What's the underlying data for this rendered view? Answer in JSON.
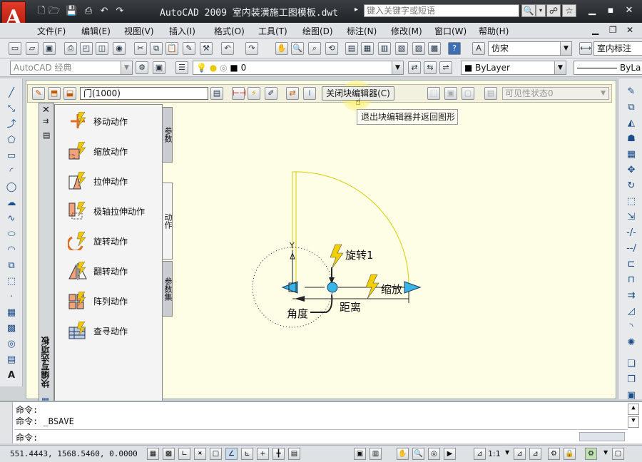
{
  "window": {
    "title": "AutoCAD 2009  室内装潢施工图模板.dwt",
    "search_placeholder": "键入关键字或短语"
  },
  "menu": [
    "文件(F)",
    "编辑(E)",
    "视图(V)",
    "插入(I)",
    "格式(O)",
    "工具(T)",
    "绘图(D)",
    "标注(N)",
    "修改(M)",
    "窗口(W)",
    "帮助(H)"
  ],
  "toolbar": {
    "text_style": "仿宋",
    "dim_style": "室内标注",
    "workspace": "AutoCAD 经典",
    "layer": "0",
    "color": "ByLayer",
    "linetype": "ByLa"
  },
  "block_editor": {
    "block_name": "门(1000)",
    "close_button": "关闭块编辑器(C)",
    "tooltip": "退出块编辑器并返回图形",
    "visibility": "可见性状态0"
  },
  "palette": {
    "title": "块编写选项板",
    "tabs": [
      "参数",
      "动作",
      "参数集"
    ],
    "items": [
      "移动动作",
      "缩放动作",
      "拉伸动作",
      "极轴拉伸动作",
      "旋转动作",
      "翻转动作",
      "阵列动作",
      "查寻动作"
    ]
  },
  "drawing": {
    "labels": {
      "rotate": "旋转1",
      "scale": "缩放",
      "angle": "角度",
      "distance": "距离",
      "ucs_y": "Y"
    }
  },
  "command": {
    "line1": "命令:",
    "line2": "命令: _BSAVE",
    "prompt": "命令:"
  },
  "status": {
    "coords": "551.4443,   1568.5460, 0.0000",
    "scale": "1:1"
  }
}
